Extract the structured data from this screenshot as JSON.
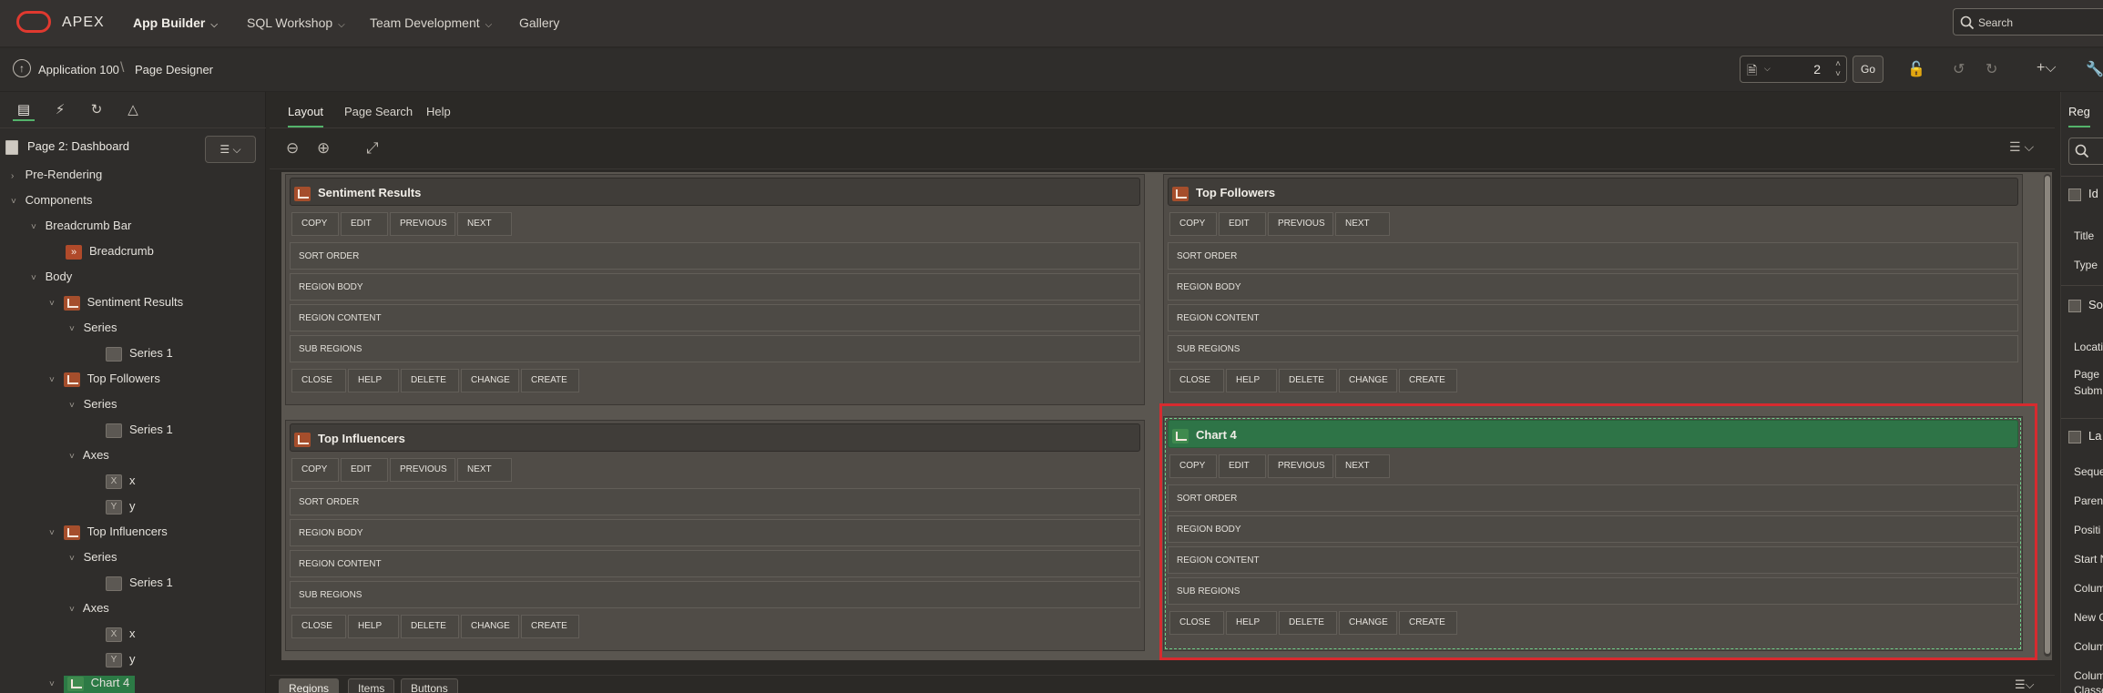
{
  "topbar": {
    "brand": "APEX",
    "nav": [
      {
        "label": "App Builder"
      },
      {
        "label": "SQL Workshop"
      },
      {
        "label": "Team Development"
      },
      {
        "label": "Gallery"
      }
    ],
    "search_placeholder": "Search"
  },
  "toolbar": {
    "breadcrumb": [
      "Application 100",
      "Page Designer"
    ],
    "page_number": "2",
    "go_label": "Go"
  },
  "left_panel": {
    "page_title": "Page 2: Dashboard",
    "tree": [
      {
        "label": "Pre-Rendering"
      },
      {
        "label": "Components"
      },
      {
        "label": "Breadcrumb Bar"
      },
      {
        "label": "Breadcrumb"
      },
      {
        "label": "Body"
      },
      {
        "label": "Sentiment Results"
      },
      {
        "label": "Series"
      },
      {
        "label": "Series 1"
      },
      {
        "label": "Top Followers"
      },
      {
        "label": "Series"
      },
      {
        "label": "Series 1"
      },
      {
        "label": "Axes"
      },
      {
        "label": "x"
      },
      {
        "label": "y"
      },
      {
        "label": "Top Influencers"
      },
      {
        "label": "Series"
      },
      {
        "label": "Series 1"
      },
      {
        "label": "Axes"
      },
      {
        "label": "x"
      },
      {
        "label": "y"
      },
      {
        "label": "Chart 4"
      }
    ]
  },
  "center": {
    "tabs": [
      {
        "label": "Layout"
      },
      {
        "label": "Page Search"
      },
      {
        "label": "Help"
      }
    ],
    "regions": [
      {
        "title": "Sentiment Results"
      },
      {
        "title": "Top Followers"
      },
      {
        "title": "Top Influencers"
      },
      {
        "title": "Chart 4"
      }
    ],
    "top_buttons": [
      "COPY",
      "EDIT",
      "PREVIOUS",
      "NEXT"
    ],
    "positions": [
      "SORT ORDER",
      "REGION BODY",
      "REGION CONTENT",
      "SUB REGIONS"
    ],
    "bottom_buttons": [
      "CLOSE",
      "HELP",
      "DELETE",
      "CHANGE",
      "CREATE"
    ],
    "bottom_tabs": [
      {
        "label": "Regions"
      },
      {
        "label": "Items"
      },
      {
        "label": "Buttons"
      }
    ]
  },
  "right_panel": {
    "tab": "Reg",
    "sections": [
      "Id",
      "So",
      "La"
    ],
    "labels": [
      "Title",
      "Type",
      "Locati",
      "Page I",
      "Submi",
      "Seque",
      "Paren",
      "Positi",
      "Start N",
      "Colum",
      "New C",
      "Colum",
      "Colum",
      "Classe"
    ]
  },
  "colors": {
    "selected_region": "#2e7447",
    "selection_outline": "#d72b2f",
    "accent": "#54b36b",
    "chart_icon": "#a54e2c"
  }
}
